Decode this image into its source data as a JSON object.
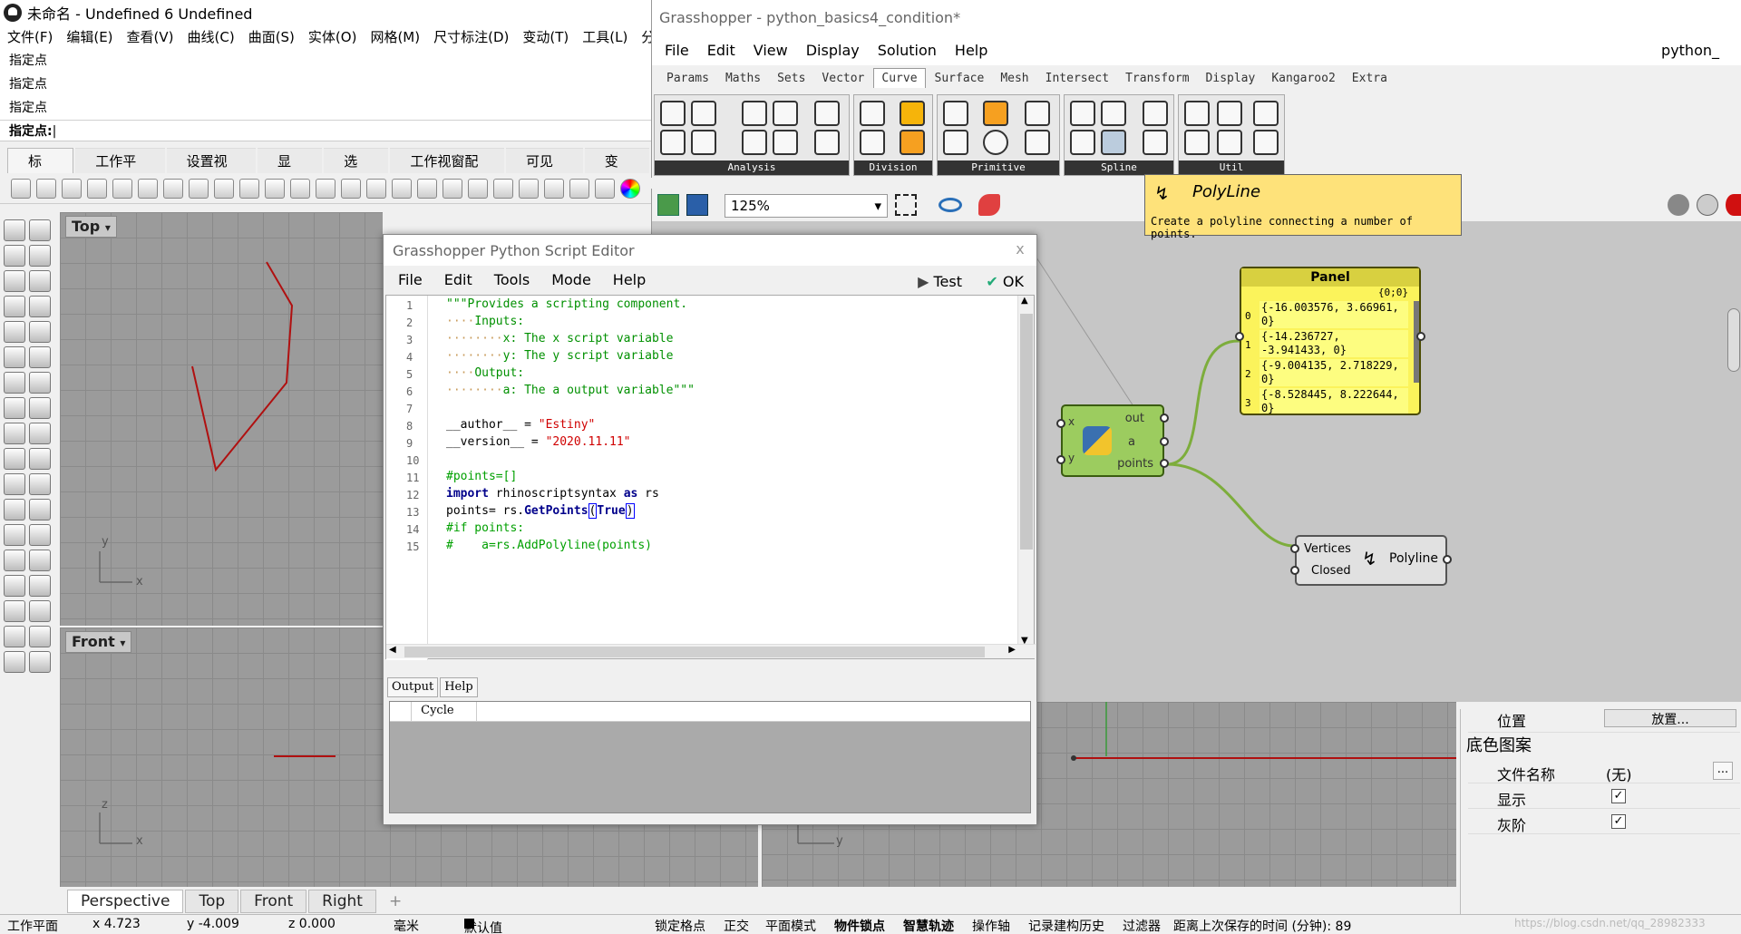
{
  "rhino": {
    "title": "未命名 - Undefined 6 Undefined",
    "menu": [
      "文件(F)",
      "编辑(E)",
      "查看(V)",
      "曲线(C)",
      "曲面(S)",
      "实体(O)",
      "网格(M)",
      "尺寸标注(D)",
      "变动(T)",
      "工具(L)",
      "分析"
    ],
    "history": [
      "指定点",
      "指定点",
      "指定点"
    ],
    "prompt": "指定点:",
    "tabs": [
      "标准",
      "工作平面",
      "设置视图",
      "显示",
      "选取",
      "工作视窗配置",
      "可见性",
      "变动"
    ],
    "viewports": {
      "top": {
        "label": "Top"
      },
      "front": {
        "label": "Front"
      }
    },
    "axis": {
      "x": "x",
      "y": "y",
      "z": "z"
    },
    "viewport_tabs": [
      "Perspective",
      "Top",
      "Front",
      "Right"
    ],
    "add_tab": "+",
    "status": {
      "cplane": "工作平面",
      "x": "x 4.723",
      "y": "y -4.009",
      "z": "z 0.000",
      "unit": "毫米",
      "layer": "默认值",
      "toggles": [
        "锁定格点",
        "正交",
        "平面模式",
        "物件锁点",
        "智慧轨迹",
        "操作轴",
        "记录建构历史",
        "过滤器"
      ],
      "saved": "距离上次保存的时间 (分钟): 89",
      "watermark": "https://blog.csdn.net/qq_28982333"
    }
  },
  "gh": {
    "title": "Grasshopper - python_basics4_condition*",
    "menu": [
      "File",
      "Edit",
      "View",
      "Display",
      "Solution",
      "Help"
    ],
    "doc_name": "python_",
    "tabs": [
      "Params",
      "Maths",
      "Sets",
      "Vector",
      "Curve",
      "Surface",
      "Mesh",
      "Intersect",
      "Transform",
      "Display",
      "Kangaroo2",
      "Extra"
    ],
    "active_tab": "Curve",
    "groups": [
      "Analysis",
      "Division",
      "Primitive",
      "Spline",
      "Util"
    ],
    "zoom": "125%",
    "tooltip": {
      "title": "PolyLine",
      "desc": "Create a polyline connecting a number of points."
    },
    "panel": {
      "title": "Panel",
      "path": "{0;0}",
      "rows": [
        {
          "i": "0",
          "v": "{-16.003576, 3.66961, 0}"
        },
        {
          "i": "1",
          "v": "{-14.236727, -3.941433, 0}"
        },
        {
          "i": "2",
          "v": "{-9.004135, 2.718229, 0}"
        },
        {
          "i": "3",
          "v": "{-8.528445, 8.222644, 0}"
        }
      ]
    },
    "python": {
      "inputs": [
        "x",
        "y"
      ],
      "outputs": [
        "out",
        "a",
        "points"
      ]
    },
    "polyline": {
      "inputs": [
        "Vertices",
        "Closed"
      ],
      "name": "Polyline"
    }
  },
  "editor": {
    "title": "Grasshopper Python Script Editor",
    "close": "x",
    "menu": [
      "File",
      "Edit",
      "Tools",
      "Mode",
      "Help"
    ],
    "test": "Test",
    "ok": "OK",
    "line_numbers": [
      "1",
      "2",
      "3",
      "4",
      "5",
      "6",
      "7",
      "8",
      "9",
      "10",
      "11",
      "12",
      "13",
      "14",
      "15"
    ],
    "out_tabs": [
      "Output",
      "Help"
    ],
    "out_header": "Cycle"
  },
  "props": {
    "position_label": "位置",
    "position_btn": "放置...",
    "section": "底色图案",
    "file_label": "文件名称",
    "file_value": "(无)",
    "browse": "...",
    "show_label": "显示",
    "gray_label": "灰阶",
    "check": "✓"
  },
  "colors": {
    "curve": "#b01010",
    "wire": "#7dad3c",
    "panel": "#fbf35b",
    "tooltip": "#fee27a"
  }
}
